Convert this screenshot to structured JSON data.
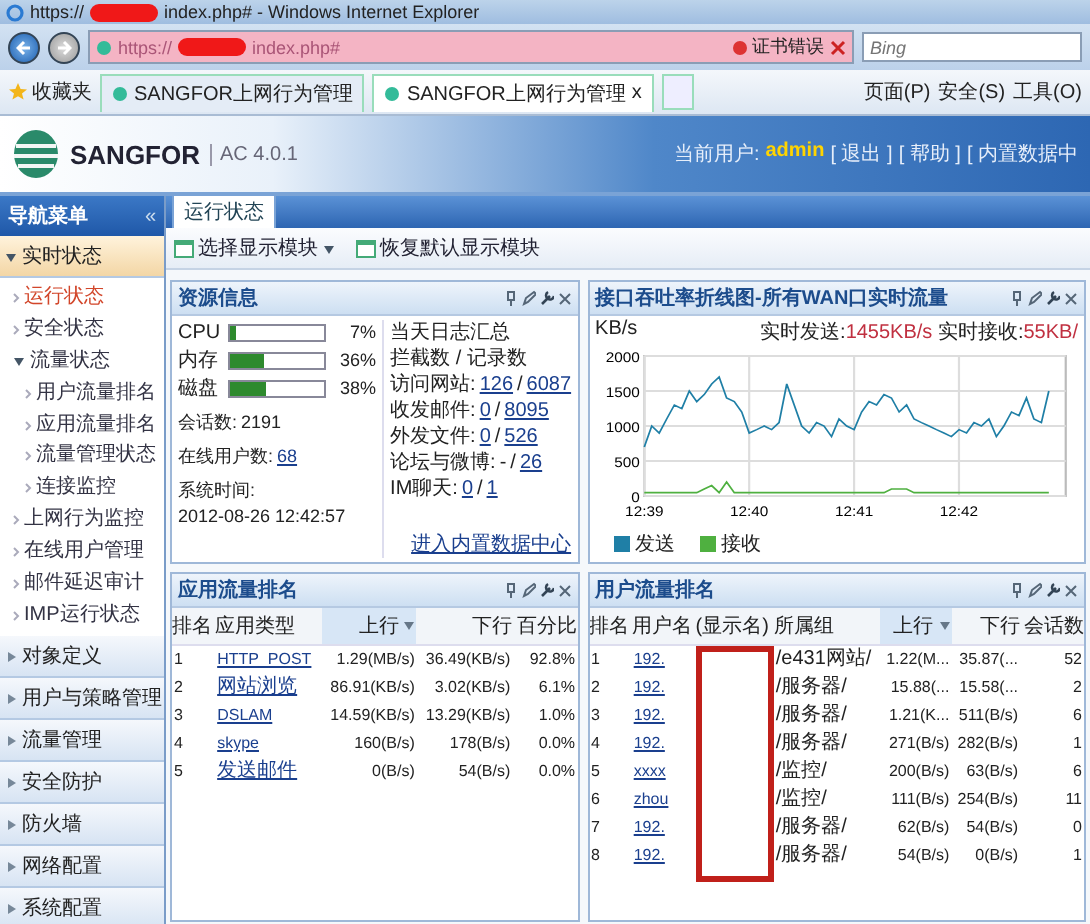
{
  "browser": {
    "title_prefix": "https://",
    "title_suffix": "index.php# - Windows Internet Explorer",
    "url_prefix": "https://",
    "url_suffix": "index.php#",
    "redacted": true,
    "cert_error": "证书错误",
    "search": {
      "placeholder": "Bing"
    },
    "favorites": "收藏夹",
    "tabs": [
      {
        "label": "SANGFOR上网行为管理",
        "selected": false
      },
      {
        "label": "SANGFOR上网行为管理",
        "selected": true
      }
    ],
    "tab_close": "x",
    "menus": [
      "页面(P)",
      "安全(S)",
      "工具(O)"
    ]
  },
  "header": {
    "brand": "SANGFOR",
    "version": "AC 4.0.1",
    "user_label": "当前用户:",
    "user": "admin",
    "links": [
      "[ 退出 ]",
      "[ 帮助 ]",
      "[ 内置数据中"
    ]
  },
  "nav": {
    "title": "导航菜单",
    "collapse": "«",
    "sections": [
      {
        "label": "实时状态",
        "expanded": true,
        "children": [
          {
            "label": "运行状态",
            "selected": true
          },
          {
            "label": "安全状态",
            "selected": false
          },
          {
            "label": "流量状态",
            "selected": false,
            "expanded": true,
            "children": [
              {
                "label": "用户流量排名",
                "selected": false
              },
              {
                "label": "应用流量排名",
                "selected": false
              },
              {
                "label": "流量管理状态",
                "selected": false
              },
              {
                "label": "连接监控",
                "selected": false
              }
            ]
          },
          {
            "label": "上网行为监控",
            "selected": false
          },
          {
            "label": "在线用户管理",
            "selected": false
          },
          {
            "label": "邮件延迟审计",
            "selected": false
          },
          {
            "label": "IMP运行状态",
            "selected": false
          }
        ]
      },
      {
        "label": "对象定义",
        "expanded": false
      },
      {
        "label": "用户与策略管理",
        "expanded": false
      },
      {
        "label": "流量管理",
        "expanded": false
      },
      {
        "label": "安全防护",
        "expanded": false
      },
      {
        "label": "防火墙",
        "expanded": false
      },
      {
        "label": "网络配置",
        "expanded": false
      },
      {
        "label": "系统配置",
        "expanded": false
      }
    ]
  },
  "content": {
    "tabs": [
      {
        "label": "运行状态",
        "selected": true
      }
    ],
    "toolbar": [
      {
        "label": "选择显示模块",
        "dropdown": true
      },
      {
        "label": "恢复默认显示模块",
        "dropdown": false
      }
    ],
    "resource": {
      "title": "资源信息",
      "meters": [
        {
          "name": "CPU",
          "level": 0.07,
          "reading": "7%"
        },
        {
          "name": "内存",
          "level": 0.36,
          "reading": "36%"
        },
        {
          "name": "磁盘",
          "level": 0.38,
          "reading": "38%"
        }
      ],
      "stats": [
        {
          "label": "会话数:",
          "value": "2191",
          "link": false
        },
        {
          "label": "在线用户数:",
          "value": "68",
          "link": true
        },
        {
          "label": "系统时间:",
          "value": "2012-08-26 12:42:57",
          "link": false
        }
      ],
      "log_title": "当天日志汇总",
      "log_header": "拦截数 / 记录数",
      "logs": [
        {
          "label": "访问网站:",
          "blocked": "126",
          "blocked_link": true,
          "separator": "/",
          "recorded": "6087"
        },
        {
          "label": "收发邮件:",
          "blocked": "0",
          "blocked_link": true,
          "separator": "/",
          "recorded": "8095"
        },
        {
          "label": "外发文件:",
          "blocked": "0",
          "blocked_link": true,
          "separator": "/",
          "recorded": "526"
        },
        {
          "label": "论坛与微博:",
          "blocked": "-",
          "blocked_link": false,
          "separator": "/",
          "recorded": "26"
        },
        {
          "label": "IM聊天:",
          "blocked": "0",
          "blocked_link": true,
          "separator": "/",
          "recorded": "1"
        }
      ],
      "link": "进入内置数据中心"
    },
    "traffic": {
      "title": "接口吞吐率折线图-所有WAN口实时流量",
      "unit": "KB/s",
      "send_label": "实时发送:",
      "send_value": "1455KB/s",
      "recv_label": "实时接收:",
      "recv_value": "55KB/",
      "chart_data": {
        "type": "line",
        "grid": true,
        "categories": [
          "12:39",
          null,
          null,
          null,
          null,
          null,
          null,
          null,
          null,
          null,
          null,
          null,
          null,
          null,
          "12:40",
          null,
          null,
          null,
          null,
          null,
          null,
          null,
          null,
          null,
          null,
          null,
          null,
          null,
          "12:41",
          null,
          null,
          null,
          null,
          null,
          null,
          null,
          null,
          null,
          null,
          null,
          null,
          null,
          "12:42",
          null,
          null,
          null,
          null,
          null,
          null,
          null,
          null,
          null,
          null,
          null,
          null
        ],
        "ylim": [
          0,
          2000
        ],
        "yticks": [
          0,
          500,
          1000,
          1500,
          2000
        ],
        "series": [
          {
            "name": "发送",
            "color": "#1f7fa6",
            "values": [
              700,
              1000,
              900,
              1100,
              1300,
              1250,
              1500,
              1350,
              1450,
              1600,
              1700,
              1400,
              1350,
              1200,
              900,
              950,
              1000,
              950,
              1050,
              1600,
              1300,
              1000,
              900,
              1050,
              1000,
              850,
              1100,
              1000,
              950,
              1200,
              1350,
              1300,
              1450,
              1400,
              1200,
              1300,
              1100,
              1050,
              1000,
              950,
              900,
              850,
              950,
              900,
              1050,
              1000,
              1100,
              850,
              1000,
              1200,
              1150,
              1400,
              1100,
              1050,
              1500
            ]
          },
          {
            "name": "接收",
            "color": "#4fb040",
            "values": [
              50,
              50,
              50,
              50,
              50,
              50,
              50,
              50,
              100,
              150,
              50,
              200,
              50,
              50,
              50,
              50,
              50,
              50,
              50,
              50,
              50,
              50,
              50,
              50,
              50,
              50,
              50,
              50,
              50,
              50,
              50,
              50,
              50,
              100,
              100,
              100,
              50,
              50,
              50,
              50,
              50,
              50,
              50,
              50,
              50,
              50,
              50,
              50,
              50,
              50,
              50,
              50,
              50,
              50,
              50
            ]
          }
        ]
      }
    },
    "app_ranking": {
      "title": "应用流量排名",
      "columns": [
        {
          "label": "排名",
          "sorted": false
        },
        {
          "label": "应用类型",
          "sorted": false,
          "link": true
        },
        {
          "label": "上行",
          "sorted": true
        },
        {
          "label": "下行",
          "sorted": false
        },
        {
          "label": "百分比",
          "sorted": false
        }
      ],
      "rows": [
        [
          "1",
          "HTTP_POST",
          "1.29(MB/s)",
          "36.49(KB/s)",
          "92.8%"
        ],
        [
          "2",
          "网站浏览",
          "86.91(KB/s)",
          "3.02(KB/s)",
          "6.1%"
        ],
        [
          "3",
          "DSLAM",
          "14.59(KB/s)",
          "13.29(KB/s)",
          "1.0%"
        ],
        [
          "4",
          "skype",
          "160(B/s)",
          "178(B/s)",
          "0.0%"
        ],
        [
          "5",
          "发送邮件",
          "0(B/s)",
          "54(B/s)",
          "0.0%"
        ]
      ]
    },
    "user_ranking": {
      "title": "用户流量排名",
      "redaction": true,
      "columns": [
        {
          "label": "排名",
          "sorted": false
        },
        {
          "label": "用户名",
          "sorted": false,
          "link": true
        },
        {
          "label": "(显示名)",
          "sorted": false
        },
        {
          "label": "所属组",
          "sorted": false
        },
        {
          "label": "上行",
          "sorted": true
        },
        {
          "label": "下行",
          "sorted": false
        },
        {
          "label": "会话数",
          "sorted": false
        }
      ],
      "rows": [
        [
          "1",
          "192.",
          "",
          "/e431网站/",
          "1.22(M...",
          "35.87(...",
          "52"
        ],
        [
          "2",
          "192.",
          "",
          "/服务器/",
          "15.88(...",
          "15.58(...",
          "2"
        ],
        [
          "3",
          "192.",
          "",
          "/服务器/",
          "1.21(K...",
          "511(B/s)",
          "6"
        ],
        [
          "4",
          "192.",
          "",
          "/服务器/",
          "271(B/s)",
          "282(B/s)",
          "1"
        ],
        [
          "5",
          "xxxx",
          "",
          "/监控/",
          "200(B/s)",
          "63(B/s)",
          "6"
        ],
        [
          "6",
          "zhou",
          "",
          "/监控/",
          "111(B/s)",
          "254(B/s)",
          "11"
        ],
        [
          "7",
          "192.",
          "",
          "/服务器/",
          "62(B/s)",
          "54(B/s)",
          "0"
        ],
        [
          "8",
          "192.",
          "",
          "/服务器/",
          "54(B/s)",
          "0(B/s)",
          "1"
        ]
      ]
    }
  }
}
